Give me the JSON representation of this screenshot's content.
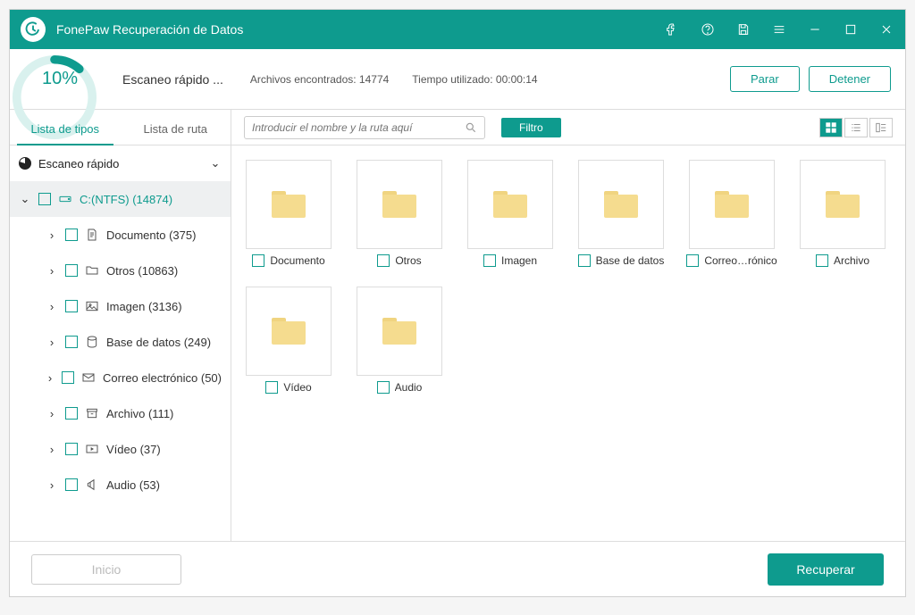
{
  "titlebar": {
    "app_title": "FonePaw Recuperación de Datos"
  },
  "status": {
    "percent": "10%",
    "scan_label": "Escaneo rápido ...",
    "found_label": "Archivos encontrados: 14774",
    "time_label": "Tiempo utilizado: 00:00:14",
    "pause_btn": "Parar",
    "stop_btn": "Detener"
  },
  "tabs": {
    "types": "Lista de tipos",
    "paths": "Lista de ruta"
  },
  "tree": {
    "header": "Escaneo rápido",
    "drive": "C:(NTFS) (14874)",
    "items": [
      "Documento (375)",
      "Otros (10863)",
      "Imagen (3136)",
      "Base de datos (249)",
      "Correo electrónico (50)",
      "Archivo (111)",
      "Vídeo (37)",
      "Audio (53)"
    ]
  },
  "toolbar": {
    "search_placeholder": "Introducir el nombre y la ruta aquí",
    "filter_btn": "Filtro"
  },
  "grid": {
    "tiles": [
      "Documento",
      "Otros",
      "Imagen",
      "Base de datos",
      "Correo…rónico",
      "Archivo",
      "Vídeo",
      "Audio"
    ]
  },
  "footer": {
    "home_btn": "Inicio",
    "recover_btn": "Recuperar"
  },
  "colors": {
    "accent": "#0e9b8e"
  }
}
